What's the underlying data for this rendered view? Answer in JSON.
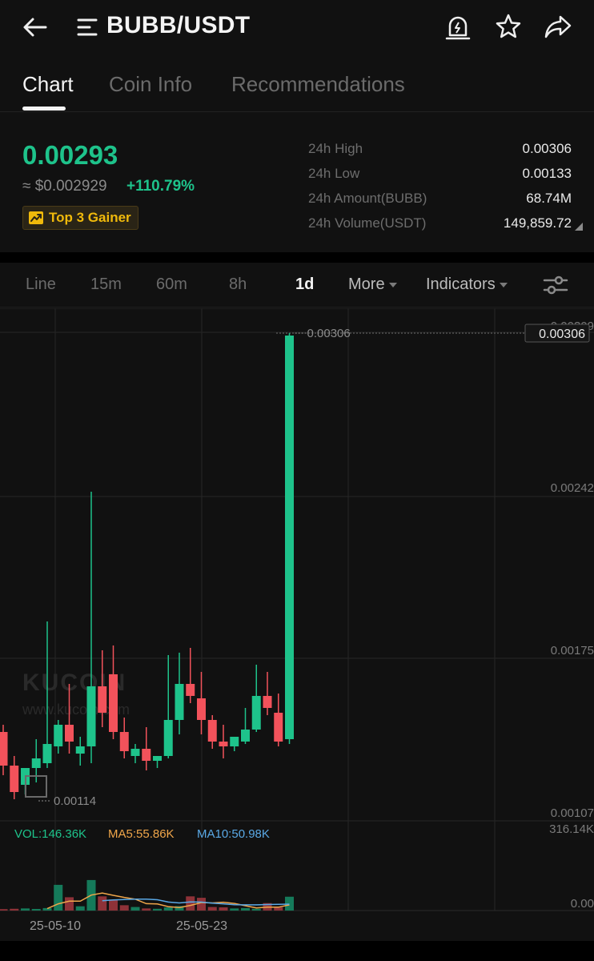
{
  "header": {
    "title": "BUBB/USDT",
    "back_icon": "arrow-left-icon",
    "menu_icon": "menu-icon",
    "alert_icon": "price-alert-icon",
    "star_icon": "favorite-star-icon",
    "share_icon": "share-icon"
  },
  "tabs": [
    {
      "label": "Chart",
      "active": true
    },
    {
      "label": "Coin Info",
      "active": false
    },
    {
      "label": "Recommendations",
      "active": false
    }
  ],
  "ticker": {
    "last_price": "0.00293",
    "usd_price": "≈ $0.002929",
    "change_pct": "+110.79%",
    "badge": "Top 3 Gainer",
    "stats": [
      {
        "label": "24h High",
        "value": "0.00306"
      },
      {
        "label": "24h Low",
        "value": "0.00133"
      },
      {
        "label": "24h Amount(BUBB)",
        "value": "68.74M"
      },
      {
        "label": "24h Volume(USDT)",
        "value": "149,859.72"
      }
    ]
  },
  "intervals": {
    "items": [
      "Line",
      "15m",
      "60m",
      "8h",
      "1d"
    ],
    "active": "1d",
    "more": "More",
    "indicators": "Indicators"
  },
  "colors": {
    "up": "#1ec38b",
    "down": "#f2525b",
    "ma5": "#f0a64a",
    "ma10": "#5aa9e6",
    "vol_label": "#1ec38b"
  },
  "chart_data": {
    "type": "candlestick",
    "interval": "1d",
    "ylim": [
      0.00107,
      0.00309
    ],
    "y_tick_labels": [
      "0.00309",
      "0.00242",
      "0.00175",
      "0.00107"
    ],
    "x_tick_labels": [
      "25-05-10",
      "25-05-23"
    ],
    "last_price_tag": "0.00306",
    "high_marker": "0.00306",
    "low_marker": "0.00114",
    "watermark": "KUCOIN",
    "watermark_url": "www.kucoin.com",
    "candles": [
      {
        "o": 0.0014,
        "h": 0.00143,
        "c": 0.00126,
        "l": 0.00122
      },
      {
        "o": 0.00126,
        "h": 0.0013,
        "c": 0.00115,
        "l": 0.00112
      },
      {
        "o": 0.00118,
        "h": 0.00123,
        "c": 0.00125,
        "l": 0.00114
      },
      {
        "o": 0.00125,
        "h": 0.00137,
        "c": 0.00129,
        "l": 0.00119
      },
      {
        "o": 0.00127,
        "h": 0.00186,
        "c": 0.00135,
        "l": 0.00125
      },
      {
        "o": 0.00134,
        "h": 0.00145,
        "c": 0.00143,
        "l": 0.00131
      },
      {
        "o": 0.00143,
        "h": 0.0016,
        "c": 0.00136,
        "l": 0.00131
      },
      {
        "o": 0.00131,
        "h": 0.00138,
        "c": 0.00134,
        "l": 0.00126
      },
      {
        "o": 0.00134,
        "h": 0.0024,
        "c": 0.00159,
        "l": 0.00127
      },
      {
        "o": 0.00159,
        "h": 0.00174,
        "c": 0.00148,
        "l": 0.00142
      },
      {
        "o": 0.00164,
        "h": 0.00176,
        "c": 0.0014,
        "l": 0.00137
      },
      {
        "o": 0.0014,
        "h": 0.00146,
        "c": 0.00132,
        "l": 0.00129
      },
      {
        "o": 0.0013,
        "h": 0.00135,
        "c": 0.00133,
        "l": 0.00127
      },
      {
        "o": 0.00133,
        "h": 0.00142,
        "c": 0.00128,
        "l": 0.00124
      },
      {
        "o": 0.00128,
        "h": 0.0013,
        "c": 0.0013,
        "l": 0.00125
      },
      {
        "o": 0.0013,
        "h": 0.00172,
        "c": 0.00145,
        "l": 0.00129
      },
      {
        "o": 0.00145,
        "h": 0.00173,
        "c": 0.0016,
        "l": 0.00139
      },
      {
        "o": 0.0016,
        "h": 0.00175,
        "c": 0.00155,
        "l": 0.00152
      },
      {
        "o": 0.00154,
        "h": 0.00165,
        "c": 0.00145,
        "l": 0.00139
      },
      {
        "o": 0.00145,
        "h": 0.00147,
        "c": 0.00136,
        "l": 0.00133
      },
      {
        "o": 0.00136,
        "h": 0.00143,
        "c": 0.00134,
        "l": 0.00129
      },
      {
        "o": 0.00134,
        "h": 0.00138,
        "c": 0.00138,
        "l": 0.00132
      },
      {
        "o": 0.00136,
        "h": 0.0015,
        "c": 0.00141,
        "l": 0.00135
      },
      {
        "o": 0.00141,
        "h": 0.00168,
        "c": 0.00155,
        "l": 0.0014
      },
      {
        "o": 0.00155,
        "h": 0.00165,
        "c": 0.0015,
        "l": 0.00147
      },
      {
        "o": 0.00148,
        "h": 0.00156,
        "c": 0.00136,
        "l": 0.00134
      },
      {
        "o": 0.00137,
        "h": 0.00306,
        "c": 0.00305,
        "l": 0.00135
      }
    ],
    "volume_series": {
      "label": "VOL:146.36K",
      "ylim": [
        0,
        316.14
      ],
      "y_tick_labels": [
        "316.14K",
        "0.00"
      ],
      "values": [
        8,
        10,
        12,
        9,
        14,
        145,
        75,
        24,
        172,
        80,
        62,
        30,
        20,
        12,
        10,
        18,
        25,
        80,
        72,
        20,
        18,
        12,
        14,
        10,
        42,
        18,
        78
      ]
    },
    "ma5": {
      "label": "MA5:55.86K",
      "values": [
        null,
        null,
        null,
        null,
        11,
        38,
        53,
        53,
        87,
        99,
        86,
        74,
        64,
        39,
        37,
        22,
        17,
        29,
        45,
        43,
        47,
        40,
        27,
        15,
        19,
        19,
        32
      ]
    },
    "ma10": {
      "label": "MA10:50.98K",
      "values": [
        null,
        null,
        null,
        null,
        null,
        null,
        null,
        null,
        null,
        55,
        60,
        62,
        64,
        64,
        61,
        48,
        43,
        49,
        48,
        42,
        38,
        33,
        32,
        32,
        34,
        35,
        36
      ]
    }
  }
}
